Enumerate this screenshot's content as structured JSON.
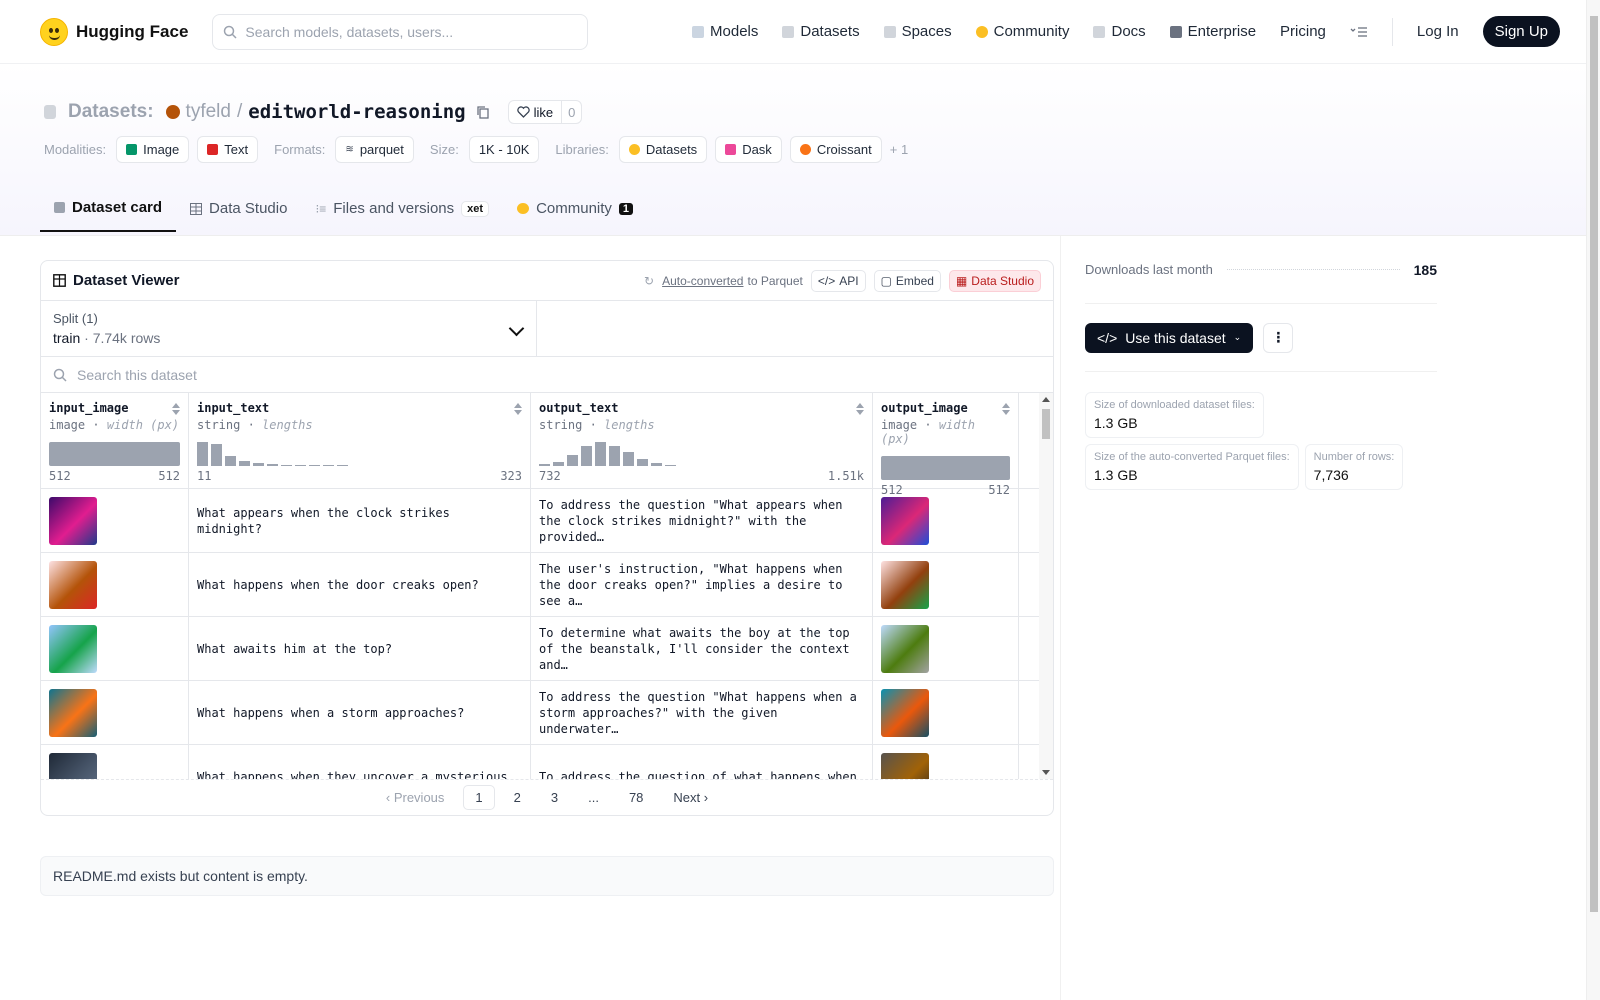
{
  "nav": {
    "brand": "Hugging Face",
    "search_placeholder": "Search models, datasets, users...",
    "links": [
      {
        "label": "Models",
        "color": "#a5b4fc"
      },
      {
        "label": "Datasets",
        "color": "#d1d5db"
      },
      {
        "label": "Spaces",
        "color": "#d1d5db"
      },
      {
        "label": "Community",
        "color": "#fbbf24"
      },
      {
        "label": "Docs",
        "color": "#d1d5db"
      },
      {
        "label": "Enterprise",
        "color": "#6b7280"
      },
      {
        "label": "Pricing",
        "color": ""
      }
    ],
    "login": "Log In",
    "signup": "Sign Up"
  },
  "repo": {
    "type_label": "Datasets:",
    "owner": "tyfeld",
    "name": "editworld-reasoning",
    "like_label": "like",
    "like_count": "0"
  },
  "tags": {
    "modalities_label": "Modalities:",
    "modalities": [
      "Image",
      "Text"
    ],
    "formats_label": "Formats:",
    "formats": [
      "parquet"
    ],
    "size_label": "Size:",
    "size": "1K - 10K",
    "libraries_label": "Libraries:",
    "libraries": [
      "Datasets",
      "Dask",
      "Croissant"
    ],
    "more": "+ 1"
  },
  "tabs": [
    {
      "label": "Dataset card",
      "active": true
    },
    {
      "label": "Data Studio"
    },
    {
      "label": "Files and versions",
      "badge": "xet"
    },
    {
      "label": "Community",
      "badge": "1"
    }
  ],
  "viewer": {
    "title": "Dataset Viewer",
    "auto_converted": "Auto-converted",
    "to_parquet": "to Parquet",
    "api": "API",
    "embed": "Embed",
    "data_studio": "Data Studio",
    "split_label": "Split (1)",
    "split_name": "train",
    "split_rows": "7.74k rows",
    "search_placeholder": "Search this dataset",
    "columns": [
      {
        "name": "input_image",
        "type": "image",
        "stat": "width (px)",
        "min": "512",
        "max": "512",
        "kind": "full"
      },
      {
        "name": "input_text",
        "type": "string",
        "stat": "lengths",
        "min": "11",
        "max": "323",
        "kind": "hist",
        "hist": [
          1.0,
          0.9,
          0.4,
          0.22,
          0.12,
          0.08,
          0.05,
          0.04,
          0.04,
          0.04,
          0.04
        ]
      },
      {
        "name": "output_text",
        "type": "string",
        "stat": "lengths",
        "min": "732",
        "max": "1.51k",
        "kind": "hist",
        "hist": [
          0.08,
          0.15,
          0.45,
          0.85,
          1.0,
          0.85,
          0.6,
          0.3,
          0.14,
          0.05
        ]
      },
      {
        "name": "output_image",
        "type": "image",
        "stat": "width (px)",
        "min": "512",
        "max": "512",
        "kind": "full"
      }
    ],
    "rows": [
      {
        "in_colors": [
          "#3b0a6a",
          "#e11d8f",
          "#1e3a8a"
        ],
        "input_text": "What appears when the clock strikes midnight?",
        "output_text": "To address the question \"What appears when the clock strikes midnight?\" with the provided…",
        "out_colors": [
          "#4c1d95",
          "#db2777",
          "#1d4ed8"
        ]
      },
      {
        "in_colors": [
          "#fde2e4",
          "#b45309",
          "#dc2626"
        ],
        "input_text": "What happens when the door creaks open?",
        "output_text": "The user's instruction, \"What happens when the door creaks open?\" implies a desire to see a…",
        "out_colors": [
          "#fee2e2",
          "#92400e",
          "#16a34a"
        ]
      },
      {
        "in_colors": [
          "#93c5fd",
          "#16a34a",
          "#bfdbfe"
        ],
        "input_text": "What awaits him at the top?",
        "output_text": "To determine what awaits the boy at the top of the beanstalk, I'll consider the context and…",
        "out_colors": [
          "#bfdbfe",
          "#4d7c0f",
          "#a3a3a3"
        ]
      },
      {
        "in_colors": [
          "#0e7490",
          "#f97316",
          "#155e75"
        ],
        "input_text": "What happens when a storm approaches?",
        "output_text": "To address the question \"What happens when a storm approaches?\" with the given underwater…",
        "out_colors": [
          "#0891b2",
          "#ea580c",
          "#164e63"
        ]
      },
      {
        "in_colors": [
          "#1f2937",
          "#475569",
          "#64748b"
        ],
        "input_text": "What happens when they uncover a mysterious",
        "output_text": "To address the question of what happens when",
        "out_colors": [
          "#57534e",
          "#a16207",
          "#292524"
        ]
      }
    ],
    "pager": {
      "prev": "Previous",
      "pages": [
        "1",
        "2",
        "3",
        "...",
        "78"
      ],
      "current": "1",
      "next": "Next"
    }
  },
  "readme": "README.md exists but content is empty.",
  "sidebar": {
    "downloads_label": "Downloads last month",
    "downloads_value": "185",
    "use_button": "Use this dataset",
    "sizes": [
      {
        "label": "Size of downloaded dataset files:",
        "value": "1.3 GB"
      },
      {
        "label": "Size of the auto-converted Parquet files:",
        "value": "1.3 GB"
      },
      {
        "label": "Number of rows:",
        "value": "7,736"
      }
    ]
  }
}
